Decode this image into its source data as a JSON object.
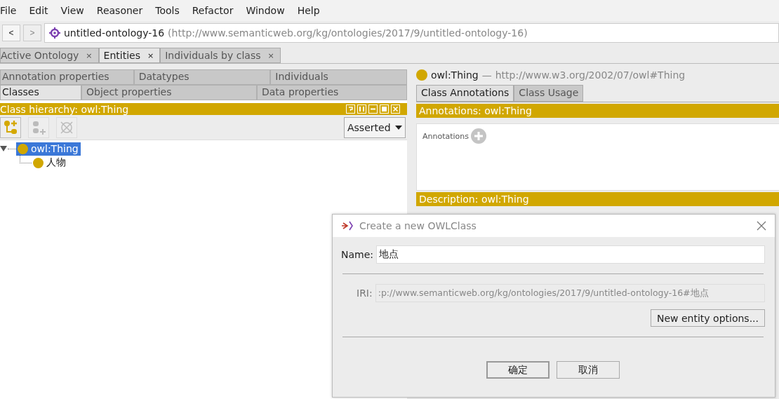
{
  "menu": [
    "File",
    "Edit",
    "View",
    "Reasoner",
    "Tools",
    "Refactor",
    "Window",
    "Help"
  ],
  "nav": {
    "back": "<",
    "forward": ">",
    "back_disabled": false,
    "forward_disabled": true,
    "ontology": "untitled-ontology-16",
    "iri": "(http://www.semanticweb.org/kg/ontologies/2017/9/untitled-ontology-16)"
  },
  "tabs": [
    {
      "label": "Active Ontology",
      "close": "×",
      "selected": false
    },
    {
      "label": "Entities",
      "close": "×",
      "selected": true
    },
    {
      "label": "Individuals by class",
      "close": "×",
      "selected": false
    }
  ],
  "entity_tabs": [
    [
      {
        "label": "Annotation properties",
        "selected": false
      },
      {
        "label": "Datatypes",
        "selected": false
      },
      {
        "label": "Individuals",
        "selected": false
      }
    ],
    [
      {
        "label": "Classes",
        "selected": true
      },
      {
        "label": "Object properties",
        "selected": false
      },
      {
        "label": "Data properties",
        "selected": false
      }
    ]
  ],
  "hierarchy": {
    "title": "Class hierarchy: owl:Thing",
    "tools": [
      {
        "kind": "add-sub",
        "disabled": false
      },
      {
        "kind": "add-sibling",
        "disabled": true
      },
      {
        "kind": "delete",
        "disabled": true
      }
    ],
    "mode": "Asserted",
    "tree": [
      {
        "label": "owl:Thing",
        "expanded": true,
        "selected": true,
        "children": [
          {
            "label": "人物",
            "selected": false
          }
        ]
      }
    ]
  },
  "entity": {
    "name": "owl:Thing",
    "dash": "—",
    "iri": "http://www.w3.org/2002/07/owl#Thing",
    "tabs": [
      {
        "label": "Class Annotations",
        "selected": true
      },
      {
        "label": "Class Usage",
        "selected": false
      }
    ],
    "annotations_title": "Annotations: owl:Thing",
    "annotations_label": "Annotations",
    "description_title": "Description: owl:Thing"
  },
  "dialog": {
    "title": "Create a new OWLClass",
    "name_label": "Name:",
    "name_value": "地点",
    "iri_label": "IRI:",
    "iri_value": ":p://www.semanticweb.org/kg/ontologies/2017/9/untitled-ontology-16#地点",
    "options_button": "New entity options...",
    "ok": "确定",
    "cancel": "取消"
  }
}
